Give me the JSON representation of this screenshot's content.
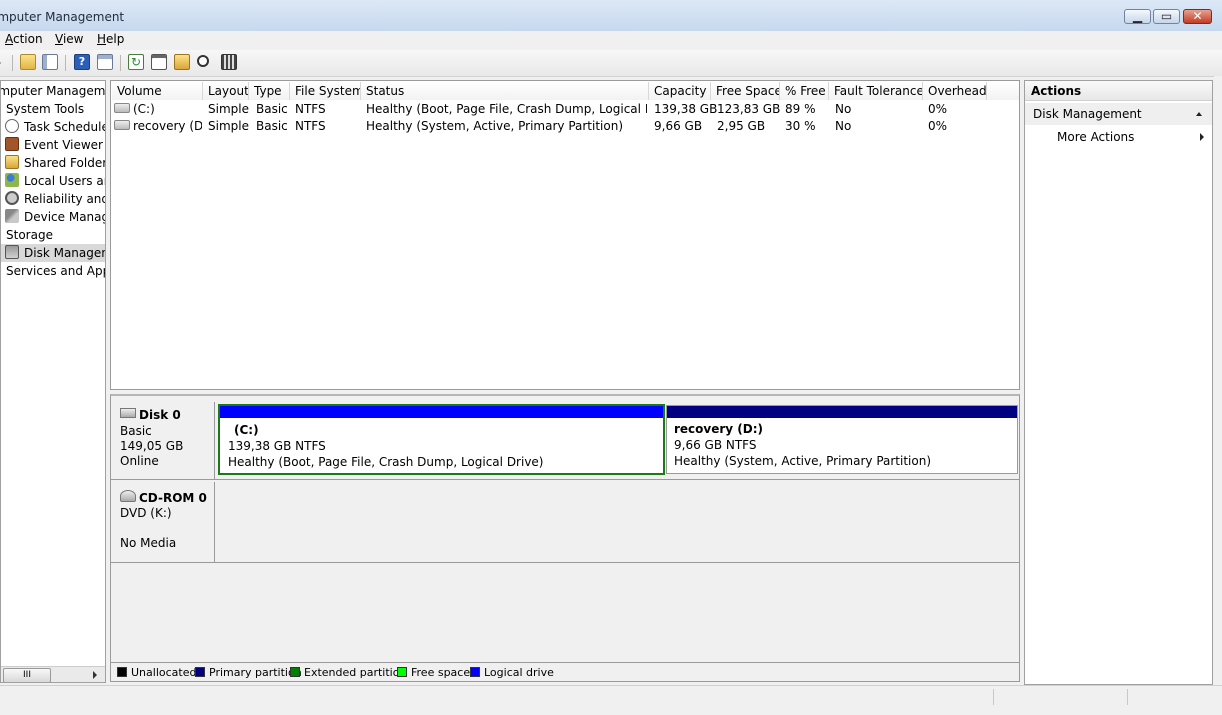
{
  "window": {
    "title": "omputer Management"
  },
  "menu": [
    "Action",
    "View",
    "Help"
  ],
  "menu_underline": [
    "A",
    "V",
    "H"
  ],
  "tree": {
    "items": [
      {
        "label": "omputer Manageme",
        "icon": "computer-icon"
      },
      {
        "label": "System Tools",
        "icon": "tools-icon"
      },
      {
        "label": "Task Scheduler",
        "icon": "clock-icon"
      },
      {
        "label": "Event Viewer",
        "icon": "event-viewer-icon"
      },
      {
        "label": "Shared Folders",
        "icon": "shared-folders-icon"
      },
      {
        "label": "Local Users and",
        "icon": "users-icon"
      },
      {
        "label": "Reliability and I",
        "icon": "reliability-icon"
      },
      {
        "label": "Device Manage",
        "icon": "device-manager-icon"
      },
      {
        "label": "Storage",
        "icon": "storage-icon"
      },
      {
        "label": "Disk Managem",
        "icon": "disk-management-icon",
        "selected": true
      },
      {
        "label": "Services and Appli",
        "icon": "services-icon"
      }
    ],
    "scroll_thumb": "III"
  },
  "volume_list": {
    "columns": [
      "Volume",
      "Layout",
      "Type",
      "File System",
      "Status",
      "Capacity",
      "Free Space",
      "% Free",
      "Fault Tolerance",
      "Overhead"
    ],
    "rows": [
      [
        "(C:)",
        "Simple",
        "Basic",
        "NTFS",
        "Healthy (Boot, Page File, Crash Dump, Logical Drive)",
        "139,38 GB",
        "123,83 GB",
        "89 %",
        "No",
        "0%"
      ],
      [
        "recovery (D:)",
        "Simple",
        "Basic",
        "NTFS",
        "Healthy (System, Active, Primary Partition)",
        "9,66 GB",
        "2,95 GB",
        "30 %",
        "No",
        "0%"
      ]
    ]
  },
  "disks": [
    {
      "name": "Disk 0",
      "type": "Basic",
      "size": "149,05 GB",
      "status": "Online",
      "partitions": [
        {
          "label": "(C:)",
          "size": "139,38 GB NTFS",
          "status": "Healthy (Boot, Page File, Crash Dump, Logical Drive)",
          "color": "#0000ff"
        },
        {
          "label": "recovery  (D:)",
          "size": "9,66 GB NTFS",
          "status": "Healthy (System, Active, Primary Partition)",
          "color": "#000080"
        }
      ]
    },
    {
      "name": "CD-ROM 0",
      "type": "DVD (K:)",
      "status": "No Media"
    }
  ],
  "legend": [
    {
      "label": "Unallocated",
      "color": "#000000"
    },
    {
      "label": "Primary partition",
      "color": "#000080"
    },
    {
      "label": "Extended partition",
      "color": "#008000"
    },
    {
      "label": "Free space",
      "color": "#00ff00"
    },
    {
      "label": "Logical drive",
      "color": "#0000ff"
    }
  ],
  "actions": {
    "header": "Actions",
    "section": "Disk Management",
    "items": [
      "More Actions"
    ]
  }
}
